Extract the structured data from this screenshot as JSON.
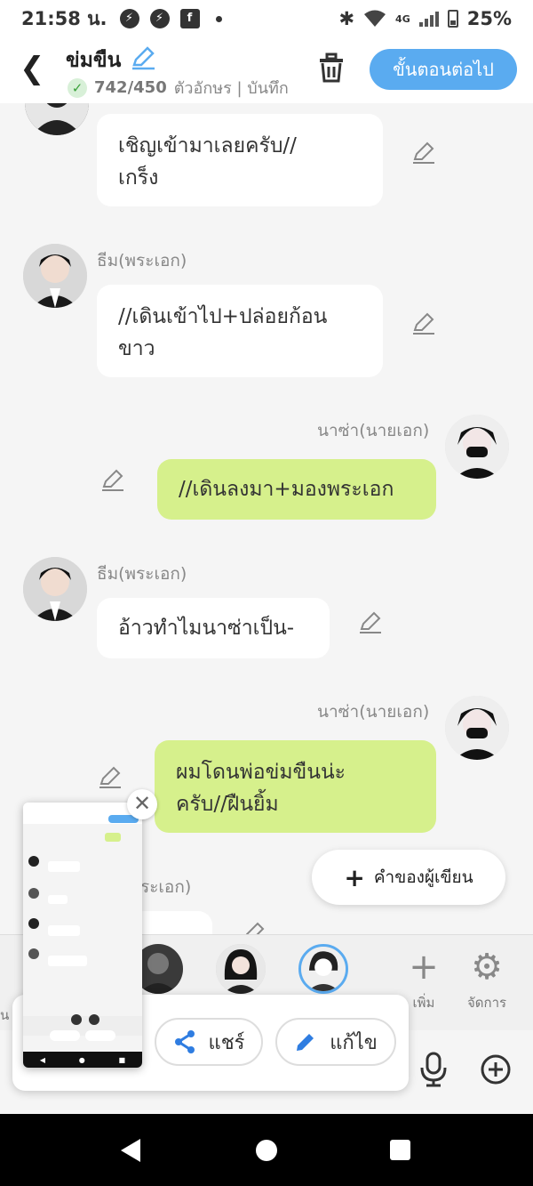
{
  "status": {
    "time": "21:58 น.",
    "battery": "25%",
    "network": "4G"
  },
  "header": {
    "title": "ข่มขืน",
    "count": "742/450",
    "subtitle_rest": "ตัวอักษร | บันทึก",
    "next_button": "ขั้นตอนต่อไป"
  },
  "messages": [
    {
      "side": "left",
      "name": "",
      "text_lines": [
        "เชิญเข้ามาเลยครับ//",
        "เกร็ง"
      ]
    },
    {
      "side": "left",
      "name": "ธีม(พระเอก)",
      "text_lines": [
        "//เดินเข้าไป+ปล่อยก้อน",
        "ขาว"
      ]
    },
    {
      "side": "right",
      "name": "นาซ่า(นายเอก)",
      "text_lines": [
        "//เดินลงมา+มองพระเอก"
      ]
    },
    {
      "side": "left",
      "name": "ธีม(พระเอก)",
      "text_lines": [
        "อ้าวทำไมนาซ่าเป็น-"
      ]
    },
    {
      "side": "right",
      "name": "นาซ่า(นายเอก)",
      "text_lines": [
        "ผมโดนพ่อข่มขืนน่ะ",
        "ครับ//ฝืนยิ้ม"
      ]
    },
    {
      "side": "left",
      "name": "ธีม(พระเอก)",
      "text_lines": [
        ""
      ]
    }
  ],
  "partial_name": "ระเอก)",
  "author_button": "คำของผู้เขียน",
  "tools": {
    "add_label": "เพิ่ม",
    "manage_label": "จัดการ",
    "partial_left_label": "น"
  },
  "share_panel": {
    "share_label": "แชร์",
    "edit_label": "แก้ไข"
  },
  "colors": {
    "accent_blue": "#5aabf0",
    "bubble_green": "#d6f08c"
  }
}
